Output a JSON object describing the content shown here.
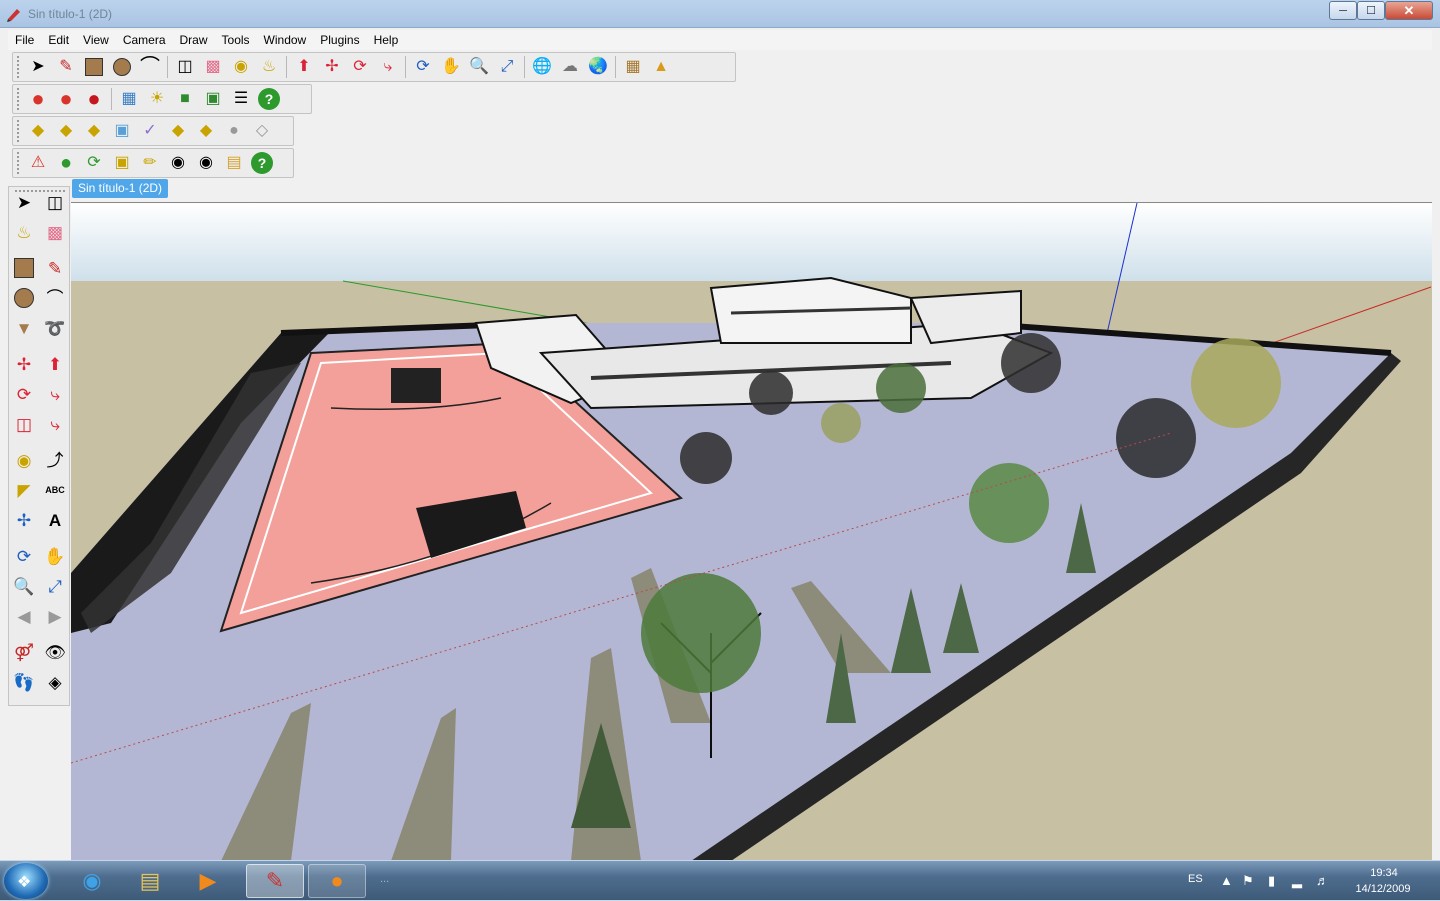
{
  "window": {
    "title": "Sin título-1 (2D)",
    "minimize": "0",
    "maximize": "1",
    "close": "r"
  },
  "menu": [
    "File",
    "Edit",
    "View",
    "Camera",
    "Draw",
    "Tools",
    "Window",
    "Plugins",
    "Help"
  ],
  "document_tab": "Sin título-1 (2D)",
  "toolbar_rows": [
    [
      "select",
      "pencil",
      "rectangle",
      "circle",
      "arc",
      "separator",
      "eraser-make",
      "eraser",
      "tape-measure",
      "paint-bucket",
      "separator",
      "push-pull",
      "move",
      "rotate",
      "follow-me",
      "separator",
      "orbit",
      "pan",
      "zoom",
      "zoom-extents",
      "separator",
      "get-models",
      "share-component",
      "share-model",
      "separator",
      "add-location",
      "photo-textures"
    ],
    [
      "shadow-red-1",
      "shadow-red-2",
      "shadow-red-3",
      "separator",
      "materials",
      "light",
      "scene",
      "image",
      "sliders",
      "help"
    ],
    [
      "tag-tool-1",
      "tag-tool-2",
      "tag-tool-3",
      "cube",
      "check",
      "tag-tool-4",
      "tag-tool-5",
      "sphere",
      "tag-tool-6"
    ],
    [
      "warning",
      "green-ball",
      "refresh",
      "clipboard",
      "brush",
      "pin",
      "camera",
      "folder",
      "help-2"
    ]
  ],
  "taskbar": {
    "language": "ES",
    "time": "19:34",
    "date": "14/12/2009",
    "status": "..."
  },
  "colors": {
    "sky": "#dbe8f0",
    "ground": "#c7c0a3",
    "court": "#f4a09a",
    "pavement": "#b4b7d4",
    "fence": "#111111",
    "accent": "#4fa6e8"
  }
}
